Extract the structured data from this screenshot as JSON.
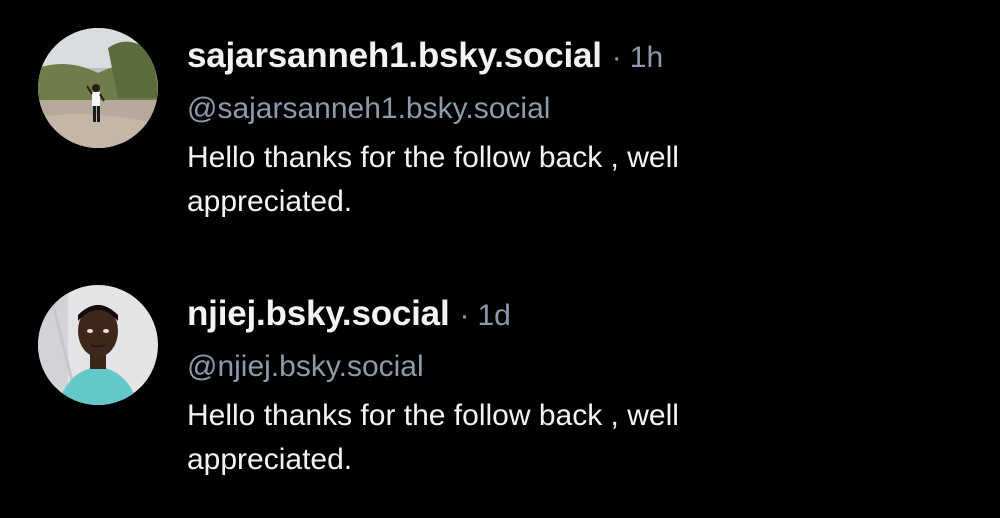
{
  "colors": {
    "background": "#000000",
    "primary_text": "#f1f3f5",
    "secondary_text": "#8d9aab"
  },
  "posts": [
    {
      "display_name": "sajarsanneh1.bsky.social",
      "separator": "·",
      "time": "1h",
      "handle": "@sajarsanneh1.bsky.social",
      "text": "Hello thanks for the follow back , well appreciated.",
      "avatar_icon": "avatar-photo-person-outdoors"
    },
    {
      "display_name": "njiej.bsky.social",
      "separator": "·",
      "time": "1d",
      "handle": "@njiej.bsky.social",
      "text": "Hello thanks for the follow back , well appreciated.",
      "avatar_icon": "avatar-photo-selfie"
    }
  ]
}
